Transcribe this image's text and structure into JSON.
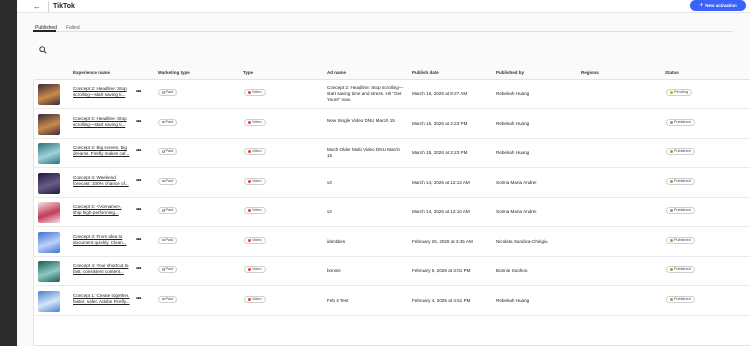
{
  "app": {
    "title": "TikTok",
    "back_icon": "arrow-left-icon",
    "new_activation_label": "New activation",
    "accent_color": "#3b63fb"
  },
  "tabs": [
    {
      "label": "Published",
      "active": true
    },
    {
      "label": "Failed",
      "active": false
    }
  ],
  "table": {
    "columns": [
      "Experience name",
      "Marketing type",
      "Type",
      "Ad name",
      "Publish date",
      "Published by",
      "Regions",
      "Status"
    ],
    "rows": [
      {
        "experience": "Concept 2: Headline: Stop scrolling—start saving ti...",
        "marketing": "Paid",
        "type": "Video",
        "ad_name": "Concept 2: Headline: Stop scrolling—start saving time and stress. Hit \"Get Yours\" now.",
        "publish_date": "March 16, 2026 at 8:27 AM",
        "published_by": "Rebekah Huang",
        "regions": "",
        "status": "Pending",
        "thumb": [
          "#3a2a3a",
          "#c98a4b"
        ]
      },
      {
        "experience": "Concept 2: Headline: Stop scrolling—start saving ti...",
        "marketing": "Paid",
        "type": "Video",
        "ad_name": "New Single Video DNU March 15",
        "publish_date": "March 15, 2026 at 2:23 PM",
        "published_by": "Rebekah Huang",
        "regions": "",
        "status": "Published",
        "thumb": [
          "#3a2a3a",
          "#c98a4b"
        ]
      },
      {
        "experience": "Concept 2: Big screen, big dreams. Firefly makes caf...",
        "marketing": "Paid",
        "type": "Video",
        "ad_name": "Much Older Multi Video DNU March 15",
        "publish_date": "March 15, 2026 at 2:23 PM",
        "published_by": "Rebekah Huang",
        "regions": "",
        "status": "Published",
        "thumb": [
          "#2d6f7a",
          "#9fd3d8"
        ]
      },
      {
        "experience": "Concept 4: Weekend forecast: 100% chance of...",
        "marketing": "Paid",
        "type": "Video",
        "ad_name": "v3",
        "publish_date": "March 14, 2026 at 12:13 AM",
        "published_by": "Sorina Maria Andrei",
        "regions": "",
        "status": "Published",
        "thumb": [
          "#1c1d3a",
          "#6a5a8a"
        ]
      },
      {
        "experience": "Concept 2: <Vorname>, ship high-performing...",
        "marketing": "Paid",
        "type": "Video",
        "ad_name": "v2",
        "publish_date": "March 14, 2026 at 12:10 AM",
        "published_by": "Sorina Maria Andrei",
        "regions": "",
        "status": "Published",
        "thumb": [
          "#f2e6ea",
          "#c23b5a"
        ]
      },
      {
        "experience": "Concept 3: From idea to document quickly. Clean...",
        "marketing": "Paid",
        "type": "Video",
        "ad_name": "identities",
        "publish_date": "February 26, 2026 at 3:45 AM",
        "published_by": "Nicoleta Sandica-Chirigiu",
        "regions": "",
        "status": "Published",
        "thumb": [
          "#3f6fd8",
          "#bcd2f7"
        ]
      },
      {
        "experience": "Concept 4: Your shortcut to fast, consistent content...",
        "marketing": "Paid",
        "type": "Video",
        "ad_name": "bonnie",
        "publish_date": "February 5, 2026 at 3:01 PM",
        "published_by": "Bonnie Soohoo",
        "regions": "",
        "status": "Published",
        "thumb": [
          "#1f5a5a",
          "#8fc9c0"
        ]
      },
      {
        "experience": "Concept 1: Create together, faster, safer. Adobe Firefly...",
        "marketing": "Paid",
        "type": "Video",
        "ad_name": "Feb 4 Test",
        "publish_date": "February 4, 2026 at 4:51 PM",
        "published_by": "Rebekah Huang",
        "regions": "",
        "status": "Published",
        "thumb": [
          "#4a7fd0",
          "#d6e6fb"
        ]
      }
    ]
  },
  "colors": {
    "video_dot": "#e0443c",
    "pending_dot": "#e0a400",
    "published_dot": "#7bb342"
  }
}
